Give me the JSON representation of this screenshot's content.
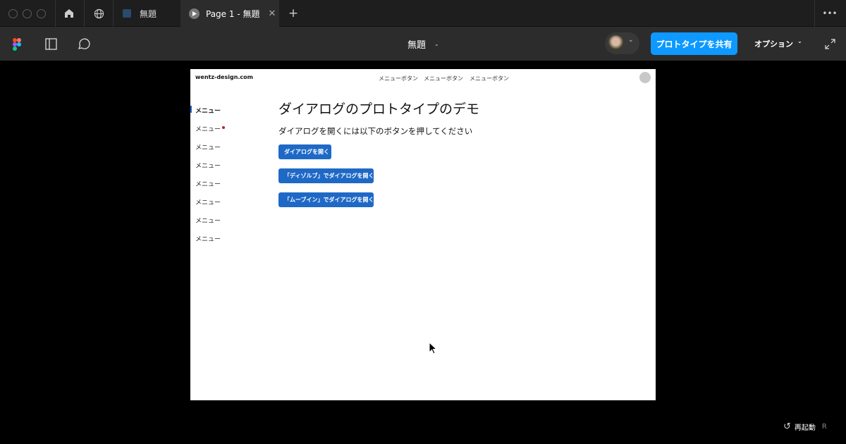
{
  "tabs": [
    {
      "label": "無題"
    },
    {
      "label": "Page 1 - 無題"
    }
  ],
  "toolbar": {
    "file_title": "無題",
    "share_label": "プロトタイプを共有",
    "options_label": "オプション"
  },
  "prototype": {
    "logo": "wentz-design.com",
    "nav": [
      "メニューボタン",
      "メニューボタン",
      "メニューボタン"
    ],
    "sidebar": [
      "メニュー",
      "メニュー",
      "メニュー",
      "メニュー",
      "メニュー",
      "メニュー",
      "メニュー",
      "メニュー"
    ],
    "title": "ダイアログのプロトタイプのデモ",
    "subtitle": "ダイアログを開くには以下のボタンを押してください",
    "buttons": [
      "ダイアログを開く",
      "「ディゾルブ」でダイアログを開く",
      "「ムーブイン」でダイアログを開く"
    ]
  },
  "footer": {
    "restart_label": "再起動",
    "restart_shortcut": "R"
  },
  "colors": {
    "accent": "#0d99ff",
    "button": "#1f69c6"
  }
}
